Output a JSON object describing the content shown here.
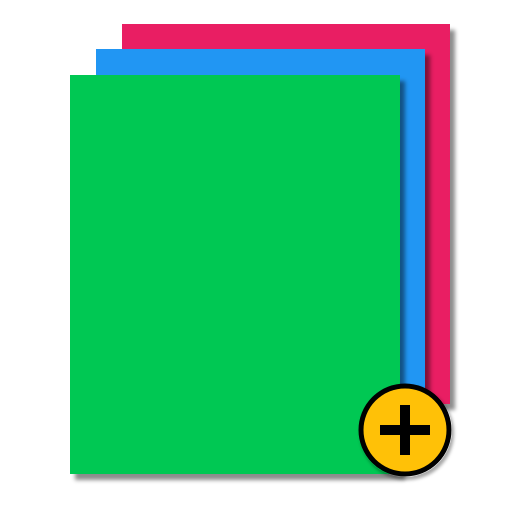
{
  "icon": {
    "name": "stacked-pages-add",
    "sheets": [
      {
        "role": "back",
        "color": "#E91E63"
      },
      {
        "role": "middle",
        "color": "#2196F3"
      },
      {
        "role": "front",
        "color": "#00C853"
      }
    ],
    "add_badge": {
      "icon": "plus-icon",
      "fill_color": "#FFC107",
      "stroke_color": "#000000",
      "glyph_color": "#000000"
    }
  }
}
